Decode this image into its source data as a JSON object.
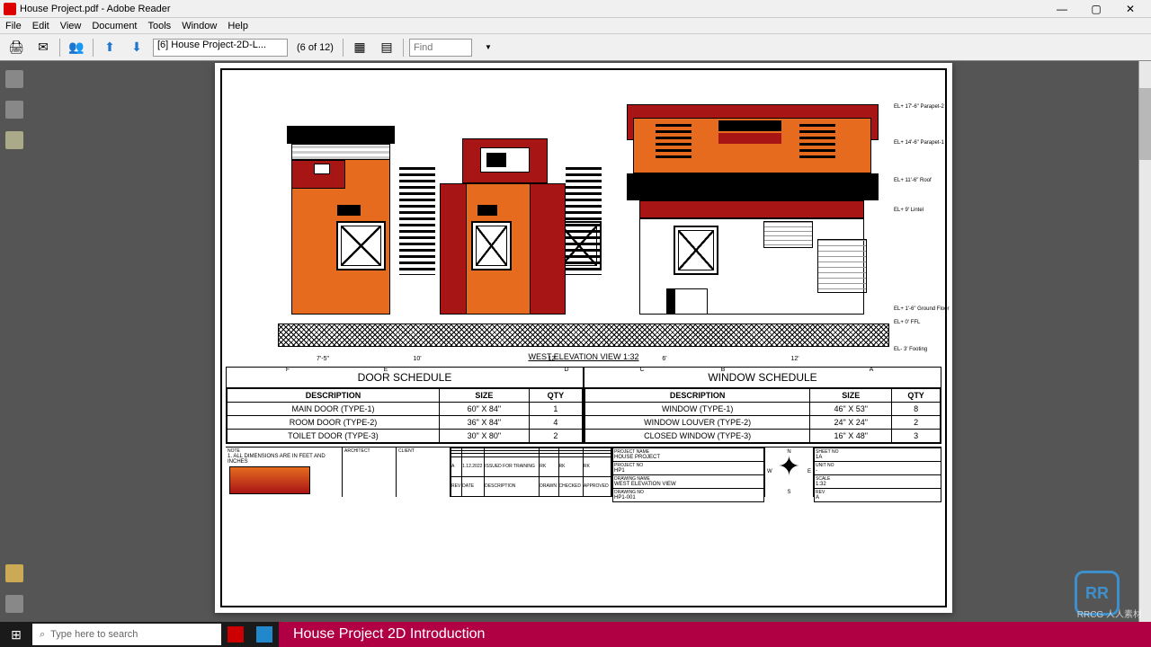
{
  "window": {
    "title": "House Project.pdf - Adobe Reader",
    "minimize": "—",
    "maximize": "▢",
    "close": "✕"
  },
  "menu": [
    "File",
    "Edit",
    "View",
    "Document",
    "Tools",
    "Window",
    "Help"
  ],
  "toolbar": {
    "doc_select": "[6] House Project-2D-L...",
    "page_info": "(6 of 12)",
    "find_placeholder": "Find"
  },
  "elevation": {
    "title": "WEST ELEVATION VIEW  1:32",
    "levels": [
      "EL+ 17'-6\" Parapet-2",
      "EL+ 14'-6\" Parapet-1",
      "EL+ 11'-6\" Roof",
      "EL+ 9' Lintel",
      "EL+ 1'-6\" Ground Floor",
      "EL+ 0' FFL",
      "EL- 3' Footing"
    ],
    "dims": [
      "7'-5\"",
      "",
      "10'",
      "",
      "12'",
      "",
      "6'",
      "",
      "12'",
      ""
    ],
    "grid_labels": [
      "F",
      "",
      "E",
      "",
      "D",
      "",
      "C",
      "",
      "B",
      "A"
    ]
  },
  "door_schedule": {
    "title": "DOOR SCHEDULE",
    "headers": [
      "DESCRIPTION",
      "SIZE",
      "QTY"
    ],
    "rows": [
      [
        "MAIN DOOR (TYPE-1)",
        "60\" X 84\"",
        "1"
      ],
      [
        "ROOM DOOR (TYPE-2)",
        "36\" X 84\"",
        "4"
      ],
      [
        "TOILET DOOR (TYPE-3)",
        "30\" X 80\"",
        "2"
      ]
    ]
  },
  "window_schedule": {
    "title": "WINDOW SCHEDULE",
    "headers": [
      "DESCRIPTION",
      "SIZE",
      "QTY"
    ],
    "rows": [
      [
        "WINDOW (TYPE-1)",
        "46\" X 53\"",
        "8"
      ],
      [
        "WINDOW LOUVER (TYPE-2)",
        "24\" X 24\"",
        "2"
      ],
      [
        "CLOSED WINDOW (TYPE-3)",
        "16\" X 48\"",
        "3"
      ]
    ]
  },
  "title_block": {
    "note_label": "NOTE",
    "note": "1. ALL DIMENSIONS ARE IN FEET AND INCHES",
    "architect": "ARCHITECT",
    "client": "CLIENT",
    "project_name_label": "PROJECT NAME",
    "project_name": "HOUSE PROJECT",
    "project_no_label": "PROJECT NO",
    "project_no": "HP1",
    "drawing_name_label": "DRAWING NAME",
    "drawing_name": "WEST ELEVATION VIEW",
    "drawing_no_label": "DRAWING NO",
    "drawing_no": "HP1-001",
    "sheet_no_label": "SHEET NO",
    "sheet_no": "1A",
    "unit_no_label": "UNIT NO",
    "unit_no": "-",
    "scale_label": "SCALE",
    "scale": "1:32",
    "rev_label": "REV",
    "rev": "A",
    "rev_date": "1.12.2022",
    "rev_desc": "ISSUED FOR TRAINING",
    "rev_by": "RK",
    "rev_chk": "RK",
    "rev_app": "RK",
    "rev_hdr": [
      "REV",
      "DATE",
      "DESCRIPTION",
      "DRAWN",
      "CHECKED",
      "APPROVED"
    ],
    "compass": {
      "n": "N",
      "s": "S",
      "e": "E",
      "w": "W"
    }
  },
  "taskbar": {
    "search_placeholder": "Type here to search"
  },
  "video_title": "House Project 2D Introduction",
  "watermark": {
    "logo": "RR",
    "text": "RRCG\n人人素材"
  }
}
